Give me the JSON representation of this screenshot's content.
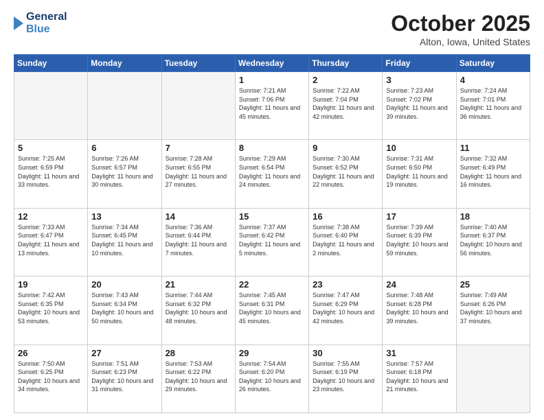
{
  "header": {
    "logo_general": "General",
    "logo_blue": "Blue",
    "month_title": "October 2025",
    "location": "Alton, Iowa, United States"
  },
  "days_of_week": [
    "Sunday",
    "Monday",
    "Tuesday",
    "Wednesday",
    "Thursday",
    "Friday",
    "Saturday"
  ],
  "weeks": [
    [
      {
        "day": "",
        "info": ""
      },
      {
        "day": "",
        "info": ""
      },
      {
        "day": "",
        "info": ""
      },
      {
        "day": "1",
        "info": "Sunrise: 7:21 AM\nSunset: 7:06 PM\nDaylight: 11 hours\nand 45 minutes."
      },
      {
        "day": "2",
        "info": "Sunrise: 7:22 AM\nSunset: 7:04 PM\nDaylight: 11 hours\nand 42 minutes."
      },
      {
        "day": "3",
        "info": "Sunrise: 7:23 AM\nSunset: 7:02 PM\nDaylight: 11 hours\nand 39 minutes."
      },
      {
        "day": "4",
        "info": "Sunrise: 7:24 AM\nSunset: 7:01 PM\nDaylight: 11 hours\nand 36 minutes."
      }
    ],
    [
      {
        "day": "5",
        "info": "Sunrise: 7:25 AM\nSunset: 6:59 PM\nDaylight: 11 hours\nand 33 minutes."
      },
      {
        "day": "6",
        "info": "Sunrise: 7:26 AM\nSunset: 6:57 PM\nDaylight: 11 hours\nand 30 minutes."
      },
      {
        "day": "7",
        "info": "Sunrise: 7:28 AM\nSunset: 6:55 PM\nDaylight: 11 hours\nand 27 minutes."
      },
      {
        "day": "8",
        "info": "Sunrise: 7:29 AM\nSunset: 6:54 PM\nDaylight: 11 hours\nand 24 minutes."
      },
      {
        "day": "9",
        "info": "Sunrise: 7:30 AM\nSunset: 6:52 PM\nDaylight: 11 hours\nand 22 minutes."
      },
      {
        "day": "10",
        "info": "Sunrise: 7:31 AM\nSunset: 6:50 PM\nDaylight: 11 hours\nand 19 minutes."
      },
      {
        "day": "11",
        "info": "Sunrise: 7:32 AM\nSunset: 6:49 PM\nDaylight: 11 hours\nand 16 minutes."
      }
    ],
    [
      {
        "day": "12",
        "info": "Sunrise: 7:33 AM\nSunset: 6:47 PM\nDaylight: 11 hours\nand 13 minutes."
      },
      {
        "day": "13",
        "info": "Sunrise: 7:34 AM\nSunset: 6:45 PM\nDaylight: 11 hours\nand 10 minutes."
      },
      {
        "day": "14",
        "info": "Sunrise: 7:36 AM\nSunset: 6:44 PM\nDaylight: 11 hours\nand 7 minutes."
      },
      {
        "day": "15",
        "info": "Sunrise: 7:37 AM\nSunset: 6:42 PM\nDaylight: 11 hours\nand 5 minutes."
      },
      {
        "day": "16",
        "info": "Sunrise: 7:38 AM\nSunset: 6:40 PM\nDaylight: 11 hours\nand 2 minutes."
      },
      {
        "day": "17",
        "info": "Sunrise: 7:39 AM\nSunset: 6:39 PM\nDaylight: 10 hours\nand 59 minutes."
      },
      {
        "day": "18",
        "info": "Sunrise: 7:40 AM\nSunset: 6:37 PM\nDaylight: 10 hours\nand 56 minutes."
      }
    ],
    [
      {
        "day": "19",
        "info": "Sunrise: 7:42 AM\nSunset: 6:35 PM\nDaylight: 10 hours\nand 53 minutes."
      },
      {
        "day": "20",
        "info": "Sunrise: 7:43 AM\nSunset: 6:34 PM\nDaylight: 10 hours\nand 50 minutes."
      },
      {
        "day": "21",
        "info": "Sunrise: 7:44 AM\nSunset: 6:32 PM\nDaylight: 10 hours\nand 48 minutes."
      },
      {
        "day": "22",
        "info": "Sunrise: 7:45 AM\nSunset: 6:31 PM\nDaylight: 10 hours\nand 45 minutes."
      },
      {
        "day": "23",
        "info": "Sunrise: 7:47 AM\nSunset: 6:29 PM\nDaylight: 10 hours\nand 42 minutes."
      },
      {
        "day": "24",
        "info": "Sunrise: 7:48 AM\nSunset: 6:28 PM\nDaylight: 10 hours\nand 39 minutes."
      },
      {
        "day": "25",
        "info": "Sunrise: 7:49 AM\nSunset: 6:26 PM\nDaylight: 10 hours\nand 37 minutes."
      }
    ],
    [
      {
        "day": "26",
        "info": "Sunrise: 7:50 AM\nSunset: 6:25 PM\nDaylight: 10 hours\nand 34 minutes."
      },
      {
        "day": "27",
        "info": "Sunrise: 7:51 AM\nSunset: 6:23 PM\nDaylight: 10 hours\nand 31 minutes."
      },
      {
        "day": "28",
        "info": "Sunrise: 7:53 AM\nSunset: 6:22 PM\nDaylight: 10 hours\nand 29 minutes."
      },
      {
        "day": "29",
        "info": "Sunrise: 7:54 AM\nSunset: 6:20 PM\nDaylight: 10 hours\nand 26 minutes."
      },
      {
        "day": "30",
        "info": "Sunrise: 7:55 AM\nSunset: 6:19 PM\nDaylight: 10 hours\nand 23 minutes."
      },
      {
        "day": "31",
        "info": "Sunrise: 7:57 AM\nSunset: 6:18 PM\nDaylight: 10 hours\nand 21 minutes."
      },
      {
        "day": "",
        "info": ""
      }
    ]
  ]
}
